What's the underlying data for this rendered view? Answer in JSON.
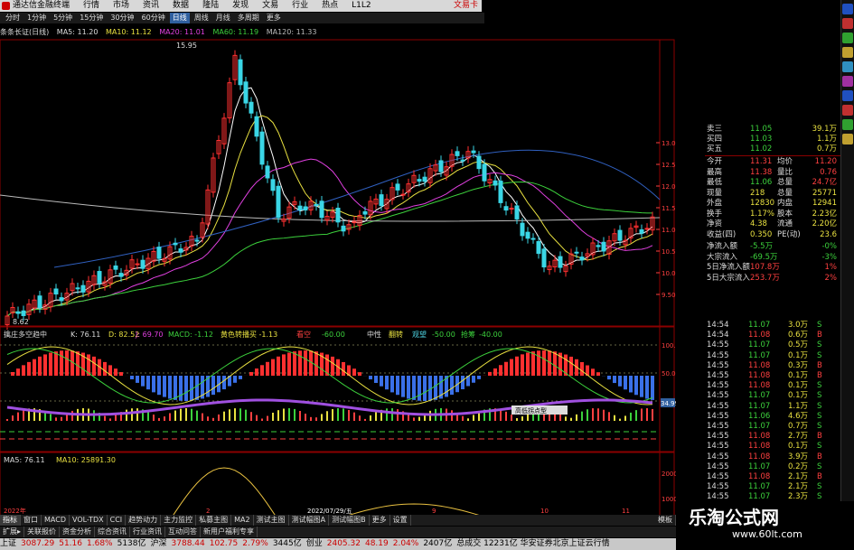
{
  "app": {
    "title": "通达信金融终端",
    "right_label": "文易卡"
  },
  "menu": [
    "行情",
    "市场",
    "资讯",
    "数据",
    "隆陆",
    "发现",
    "文易",
    "行业",
    "热点",
    "L1L2"
  ],
  "periods": [
    "分时",
    "1分钟",
    "5分钟",
    "15分钟",
    "30分钟",
    "60分钟",
    "日线",
    "周线",
    "月线",
    "多周期",
    "更多"
  ],
  "period_selected": "日线",
  "ma_line": {
    "name": "条条长证(日线)",
    "ma5": "MA5: 11.20",
    "ma10": "MA10: 11.12",
    "ma20": "MA20: 11.01",
    "ma60": "MA60: 11.19",
    "ma120": "MA120: 11.33"
  },
  "price_axis": [
    "13.00",
    "12.50",
    "12.00",
    "11.50",
    "11.00",
    "10.50",
    "10.00",
    "9.50"
  ],
  "annotations": {
    "high": "15.95",
    "low": "8.62"
  },
  "ind1": {
    "name": "擒庄多空趋中",
    "k": "K: 76.11",
    "d": "D: 82.52",
    "j": "J: 69.70",
    "macd": "MACD: -1.12",
    "yellow": "黄色转播买 -1.13",
    "sell": "看空",
    "sell_v": "-60.00",
    "mid": "中性",
    "mid2": "翻转",
    "watch": "观望",
    "watch_v": "-50.00",
    "buy": "抢筹",
    "buy_v": "-40.00",
    "axis": [
      "100.0",
      "50.0",
      "0.00"
    ],
    "current": "34.99",
    "tip": "高低拐点型"
  },
  "ind2": {
    "ma5": "MA5: 76.11",
    "ma10": "MA10: 25891.30",
    "axis": [
      "20000",
      "10000"
    ]
  },
  "date_axis": [
    "2022年",
    "2",
    "2022/07/29/五",
    "9",
    "10",
    "11"
  ],
  "quote": [
    {
      "l": "卖三",
      "p": "11.05",
      "v": "39.1万"
    },
    {
      "l": "买四",
      "p": "11.03",
      "v": "1.1万"
    },
    {
      "l": "买五",
      "p": "11.02",
      "v": "0.7万"
    }
  ],
  "stats": [
    {
      "l": "今开",
      "p": "11.31",
      "l2": "均价",
      "v": "11.20"
    },
    {
      "l": "最高",
      "p": "11.38",
      "l2": "量比",
      "v": "0.76"
    },
    {
      "l": "最低",
      "p": "11.06",
      "l2": "总量",
      "v": "24.7亿"
    },
    {
      "l": "现量",
      "p": "218",
      "l2": "总量",
      "v": "25771"
    },
    {
      "l": "外盘",
      "p": "12830",
      "l2": "内盘",
      "v": "12941"
    },
    {
      "l": "换手",
      "p": "1.17%",
      "l2": "股本",
      "v": "2.23亿"
    },
    {
      "l": "净资",
      "p": "4.38",
      "l2": "流通",
      "v": "2.20亿"
    },
    {
      "l": "收益(四)",
      "p": "0.350",
      "l2": "PE(动)",
      "v": "23.6"
    }
  ],
  "flows": [
    {
      "l": "净流入额",
      "v": "-5.5万",
      "pct": "-0%"
    },
    {
      "l": "大宗流入",
      "v": "-69.5万",
      "pct": "-3%"
    },
    {
      "l": "5日净流入额",
      "v": "107.8万",
      "pct": "1%"
    },
    {
      "l": "5日大宗流入",
      "v": "253.7万",
      "pct": "2%"
    }
  ],
  "ticks": [
    {
      "t": "14:54",
      "p": "11.07",
      "v": "3.0万",
      "d": "S"
    },
    {
      "t": "14:54",
      "p": "11.08",
      "v": "0.6万",
      "d": "B"
    },
    {
      "t": "14:55",
      "p": "11.07",
      "v": "0.5万",
      "d": "S"
    },
    {
      "t": "14:55",
      "p": "11.07",
      "v": "0.1万",
      "d": "S"
    },
    {
      "t": "14:55",
      "p": "11.08",
      "v": "0.3万",
      "d": "B"
    },
    {
      "t": "14:55",
      "p": "11.08",
      "v": "0.1万",
      "d": "B"
    },
    {
      "t": "14:55",
      "p": "11.08",
      "v": "0.1万",
      "d": "S"
    },
    {
      "t": "14:55",
      "p": "11.07",
      "v": "0.1万",
      "d": "S"
    },
    {
      "t": "14:55",
      "p": "11.07",
      "v": "1.1万",
      "d": "S"
    },
    {
      "t": "14:55",
      "p": "11.06",
      "v": "4.6万",
      "d": "S"
    },
    {
      "t": "14:55",
      "p": "11.07",
      "v": "0.7万",
      "d": "S"
    },
    {
      "t": "14:55",
      "p": "11.08",
      "v": "2.7万",
      "d": "B"
    },
    {
      "t": "14:55",
      "p": "11.08",
      "v": "0.1万",
      "d": "S"
    },
    {
      "t": "14:55",
      "p": "11.08",
      "v": "3.9万",
      "d": "B"
    },
    {
      "t": "14:55",
      "p": "11.07",
      "v": "0.2万",
      "d": "S"
    },
    {
      "t": "14:55",
      "p": "11.08",
      "v": "2.1万",
      "d": "B"
    },
    {
      "t": "14:55",
      "p": "11.07",
      "v": "2.1万",
      "d": "S"
    },
    {
      "t": "14:55",
      "p": "11.07",
      "v": "2.3万",
      "d": "S"
    },
    {
      "t": "14:55",
      "p": "11.08",
      "v": "2.1万",
      "d": "B"
    }
  ],
  "tabs": [
    "指标",
    "窗口",
    "MACD",
    "VOL-TDX",
    "CCI",
    "趋势动力",
    "主力监控",
    "私募主图",
    "MA2",
    "测试主图",
    "测试幅图A",
    "测试幅图B",
    "更多",
    "设置"
  ],
  "tab_right": "模板",
  "tabs2": [
    "扩展▸",
    "关联报价",
    "资金分析",
    "综合资讯",
    "行业资讯",
    "互动问答",
    "新用户福利专享"
  ],
  "status": [
    {
      "l": "上证",
      "v": "3087.29",
      "c": "51.16",
      "p": "1.68%",
      "a": "5138亿"
    },
    {
      "l": "沪深",
      "v": "3788.44",
      "c": "102.75",
      "p": "2.79%",
      "a": "3445亿"
    },
    {
      "l": "创业",
      "v": "2405.32",
      "c": "48.19",
      "p": "2.04%",
      "a": "2407亿"
    }
  ],
  "status_tail": "总成交 12231亿 华安证券北京上证云行情",
  "watermark": {
    "title": "乐淘公式网",
    "url": "www.60lt.com"
  },
  "rp_footer": "图文 F10"
}
